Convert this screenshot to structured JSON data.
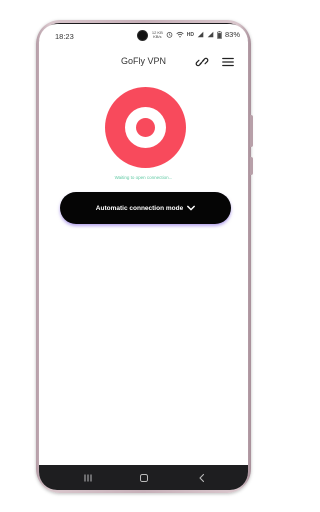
{
  "status_bar": {
    "time": "18:23",
    "net_speed_value": "12 KB",
    "net_speed_unit": "KB/s",
    "network_type": "HD",
    "battery": "83%"
  },
  "app": {
    "title": "GoFly VPN",
    "link_icon": "link-icon",
    "menu_icon": "hamburger-menu-icon"
  },
  "connection": {
    "status_text": "Waiting to open connection...",
    "mode_label": "Automatic connection mode",
    "mode_icon": "chevron-down-icon"
  },
  "nav": {
    "recents_icon": "recents-icon",
    "home_icon": "home-icon",
    "back_icon": "back-icon"
  },
  "colors": {
    "accent_red": "#f84a5c",
    "status_green": "#5fc9a3",
    "button_black": "#050505",
    "button_glow": "#7b5adc",
    "phone_frame": "#c7b0b9"
  }
}
